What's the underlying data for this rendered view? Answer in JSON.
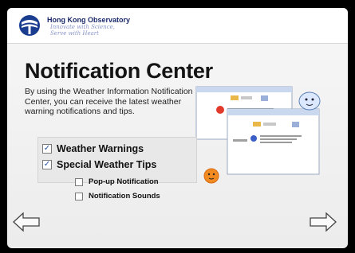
{
  "header": {
    "org_name": "Hong Kong Observatory",
    "motto_line1": "Innovate with Science,",
    "motto_line2": "Serve with Heart"
  },
  "main": {
    "title": "Notification Center",
    "description": "By using the Weather Information Notification Center, you can receive the latest weather warning notifications and tips."
  },
  "options": [
    {
      "label": "Weather Warnings",
      "checked": true
    },
    {
      "label": "Special Weather Tips",
      "checked": true
    },
    {
      "label": "Pop-up Notification",
      "checked": false
    },
    {
      "label": "Notification Sounds",
      "checked": false
    }
  ],
  "navigation": {
    "previous_icon": "left-arrow-icon",
    "next_icon": "right-arrow-icon"
  },
  "colors": {
    "logo_blue": "#1a3d8f",
    "title_text": "#141414",
    "check_blue": "#2455a4"
  }
}
